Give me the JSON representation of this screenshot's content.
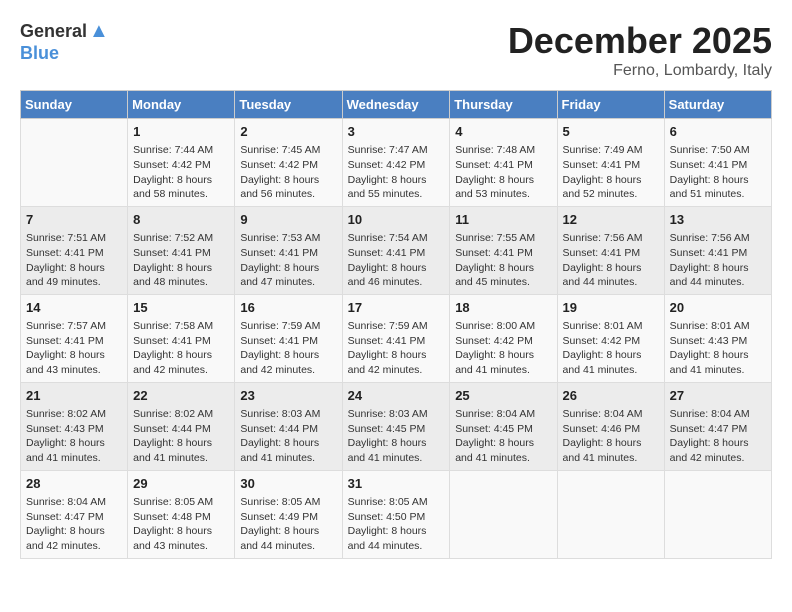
{
  "header": {
    "logo_general": "General",
    "logo_blue": "Blue",
    "month": "December 2025",
    "location": "Ferno, Lombardy, Italy"
  },
  "weekdays": [
    "Sunday",
    "Monday",
    "Tuesday",
    "Wednesday",
    "Thursday",
    "Friday",
    "Saturday"
  ],
  "weeks": [
    [
      {
        "day": "",
        "sunrise": "",
        "sunset": "",
        "daylight": ""
      },
      {
        "day": "1",
        "sunrise": "Sunrise: 7:44 AM",
        "sunset": "Sunset: 4:42 PM",
        "daylight": "Daylight: 8 hours and 58 minutes."
      },
      {
        "day": "2",
        "sunrise": "Sunrise: 7:45 AM",
        "sunset": "Sunset: 4:42 PM",
        "daylight": "Daylight: 8 hours and 56 minutes."
      },
      {
        "day": "3",
        "sunrise": "Sunrise: 7:47 AM",
        "sunset": "Sunset: 4:42 PM",
        "daylight": "Daylight: 8 hours and 55 minutes."
      },
      {
        "day": "4",
        "sunrise": "Sunrise: 7:48 AM",
        "sunset": "Sunset: 4:41 PM",
        "daylight": "Daylight: 8 hours and 53 minutes."
      },
      {
        "day": "5",
        "sunrise": "Sunrise: 7:49 AM",
        "sunset": "Sunset: 4:41 PM",
        "daylight": "Daylight: 8 hours and 52 minutes."
      },
      {
        "day": "6",
        "sunrise": "Sunrise: 7:50 AM",
        "sunset": "Sunset: 4:41 PM",
        "daylight": "Daylight: 8 hours and 51 minutes."
      }
    ],
    [
      {
        "day": "7",
        "sunrise": "Sunrise: 7:51 AM",
        "sunset": "Sunset: 4:41 PM",
        "daylight": "Daylight: 8 hours and 49 minutes."
      },
      {
        "day": "8",
        "sunrise": "Sunrise: 7:52 AM",
        "sunset": "Sunset: 4:41 PM",
        "daylight": "Daylight: 8 hours and 48 minutes."
      },
      {
        "day": "9",
        "sunrise": "Sunrise: 7:53 AM",
        "sunset": "Sunset: 4:41 PM",
        "daylight": "Daylight: 8 hours and 47 minutes."
      },
      {
        "day": "10",
        "sunrise": "Sunrise: 7:54 AM",
        "sunset": "Sunset: 4:41 PM",
        "daylight": "Daylight: 8 hours and 46 minutes."
      },
      {
        "day": "11",
        "sunrise": "Sunrise: 7:55 AM",
        "sunset": "Sunset: 4:41 PM",
        "daylight": "Daylight: 8 hours and 45 minutes."
      },
      {
        "day": "12",
        "sunrise": "Sunrise: 7:56 AM",
        "sunset": "Sunset: 4:41 PM",
        "daylight": "Daylight: 8 hours and 44 minutes."
      },
      {
        "day": "13",
        "sunrise": "Sunrise: 7:56 AM",
        "sunset": "Sunset: 4:41 PM",
        "daylight": "Daylight: 8 hours and 44 minutes."
      }
    ],
    [
      {
        "day": "14",
        "sunrise": "Sunrise: 7:57 AM",
        "sunset": "Sunset: 4:41 PM",
        "daylight": "Daylight: 8 hours and 43 minutes."
      },
      {
        "day": "15",
        "sunrise": "Sunrise: 7:58 AM",
        "sunset": "Sunset: 4:41 PM",
        "daylight": "Daylight: 8 hours and 42 minutes."
      },
      {
        "day": "16",
        "sunrise": "Sunrise: 7:59 AM",
        "sunset": "Sunset: 4:41 PM",
        "daylight": "Daylight: 8 hours and 42 minutes."
      },
      {
        "day": "17",
        "sunrise": "Sunrise: 7:59 AM",
        "sunset": "Sunset: 4:41 PM",
        "daylight": "Daylight: 8 hours and 42 minutes."
      },
      {
        "day": "18",
        "sunrise": "Sunrise: 8:00 AM",
        "sunset": "Sunset: 4:42 PM",
        "daylight": "Daylight: 8 hours and 41 minutes."
      },
      {
        "day": "19",
        "sunrise": "Sunrise: 8:01 AM",
        "sunset": "Sunset: 4:42 PM",
        "daylight": "Daylight: 8 hours and 41 minutes."
      },
      {
        "day": "20",
        "sunrise": "Sunrise: 8:01 AM",
        "sunset": "Sunset: 4:43 PM",
        "daylight": "Daylight: 8 hours and 41 minutes."
      }
    ],
    [
      {
        "day": "21",
        "sunrise": "Sunrise: 8:02 AM",
        "sunset": "Sunset: 4:43 PM",
        "daylight": "Daylight: 8 hours and 41 minutes."
      },
      {
        "day": "22",
        "sunrise": "Sunrise: 8:02 AM",
        "sunset": "Sunset: 4:44 PM",
        "daylight": "Daylight: 8 hours and 41 minutes."
      },
      {
        "day": "23",
        "sunrise": "Sunrise: 8:03 AM",
        "sunset": "Sunset: 4:44 PM",
        "daylight": "Daylight: 8 hours and 41 minutes."
      },
      {
        "day": "24",
        "sunrise": "Sunrise: 8:03 AM",
        "sunset": "Sunset: 4:45 PM",
        "daylight": "Daylight: 8 hours and 41 minutes."
      },
      {
        "day": "25",
        "sunrise": "Sunrise: 8:04 AM",
        "sunset": "Sunset: 4:45 PM",
        "daylight": "Daylight: 8 hours and 41 minutes."
      },
      {
        "day": "26",
        "sunrise": "Sunrise: 8:04 AM",
        "sunset": "Sunset: 4:46 PM",
        "daylight": "Daylight: 8 hours and 41 minutes."
      },
      {
        "day": "27",
        "sunrise": "Sunrise: 8:04 AM",
        "sunset": "Sunset: 4:47 PM",
        "daylight": "Daylight: 8 hours and 42 minutes."
      }
    ],
    [
      {
        "day": "28",
        "sunrise": "Sunrise: 8:04 AM",
        "sunset": "Sunset: 4:47 PM",
        "daylight": "Daylight: 8 hours and 42 minutes."
      },
      {
        "day": "29",
        "sunrise": "Sunrise: 8:05 AM",
        "sunset": "Sunset: 4:48 PM",
        "daylight": "Daylight: 8 hours and 43 minutes."
      },
      {
        "day": "30",
        "sunrise": "Sunrise: 8:05 AM",
        "sunset": "Sunset: 4:49 PM",
        "daylight": "Daylight: 8 hours and 44 minutes."
      },
      {
        "day": "31",
        "sunrise": "Sunrise: 8:05 AM",
        "sunset": "Sunset: 4:50 PM",
        "daylight": "Daylight: 8 hours and 44 minutes."
      },
      {
        "day": "",
        "sunrise": "",
        "sunset": "",
        "daylight": ""
      },
      {
        "day": "",
        "sunrise": "",
        "sunset": "",
        "daylight": ""
      },
      {
        "day": "",
        "sunrise": "",
        "sunset": "",
        "daylight": ""
      }
    ]
  ]
}
